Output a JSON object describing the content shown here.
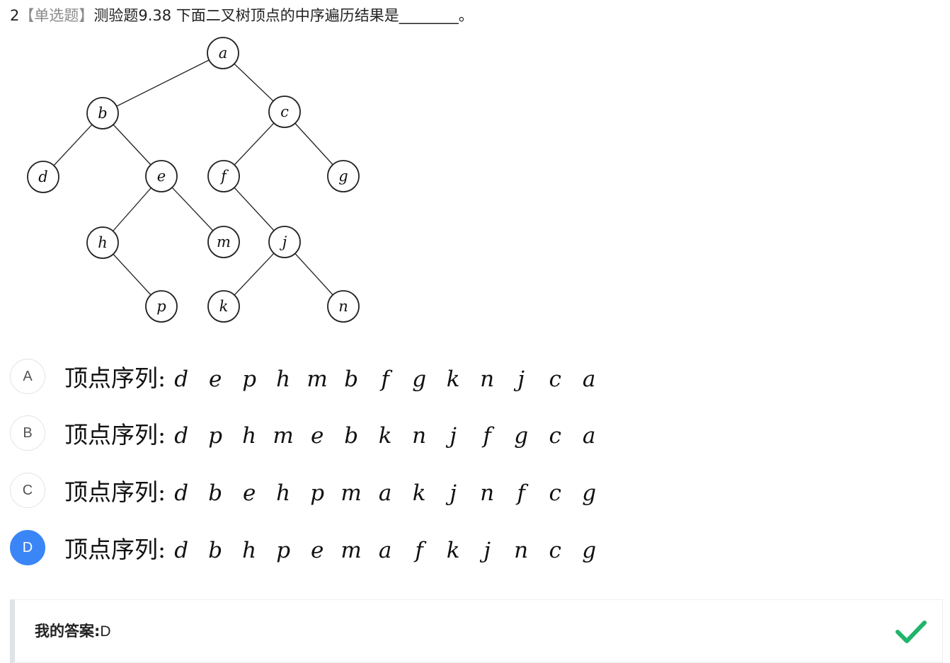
{
  "question": {
    "number": "2",
    "type_label": "【单选题】",
    "text": "测验题9.38 下面二叉树顶点的中序遍历结果是________。"
  },
  "tree": {
    "nodes": [
      {
        "id": "a",
        "label": "a"
      },
      {
        "id": "b",
        "label": "b"
      },
      {
        "id": "c",
        "label": "c"
      },
      {
        "id": "d",
        "label": "d"
      },
      {
        "id": "e",
        "label": "e"
      },
      {
        "id": "f",
        "label": "f"
      },
      {
        "id": "g",
        "label": "g"
      },
      {
        "id": "h",
        "label": "h"
      },
      {
        "id": "m",
        "label": "m"
      },
      {
        "id": "j",
        "label": "j"
      },
      {
        "id": "p",
        "label": "p"
      },
      {
        "id": "k",
        "label": "k"
      },
      {
        "id": "n",
        "label": "n"
      }
    ],
    "edges": [
      [
        "a",
        "b"
      ],
      [
        "a",
        "c"
      ],
      [
        "b",
        "d"
      ],
      [
        "b",
        "e"
      ],
      [
        "c",
        "f"
      ],
      [
        "c",
        "g"
      ],
      [
        "e",
        "h"
      ],
      [
        "e",
        "m"
      ],
      [
        "f",
        "j"
      ],
      [
        "h",
        "p"
      ],
      [
        "j",
        "k"
      ],
      [
        "j",
        "n"
      ]
    ]
  },
  "options": [
    {
      "letter": "A",
      "label": "顶点序列:",
      "sequence": [
        "d",
        "e",
        "p",
        "h",
        "m",
        "b",
        "f",
        "g",
        "k",
        "n",
        "j",
        "c",
        "a"
      ],
      "selected": false
    },
    {
      "letter": "B",
      "label": "顶点序列:",
      "sequence": [
        "d",
        "p",
        "h",
        "m",
        "e",
        "b",
        "k",
        "n",
        "j",
        "f",
        "g",
        "c",
        "a"
      ],
      "selected": false
    },
    {
      "letter": "C",
      "label": "顶点序列:",
      "sequence": [
        "d",
        "b",
        "e",
        "h",
        "p",
        "m",
        "a",
        "k",
        "j",
        "n",
        "f",
        "c",
        "g"
      ],
      "selected": false
    },
    {
      "letter": "D",
      "label": "顶点序列:",
      "sequence": [
        "d",
        "b",
        "h",
        "p",
        "e",
        "m",
        "a",
        "f",
        "k",
        "j",
        "n",
        "c",
        "g"
      ],
      "selected": true
    }
  ],
  "answer": {
    "label": "我的答案:",
    "value": "D",
    "status_icon": "check-icon",
    "status_color": "#1fb56a"
  },
  "colors": {
    "selected_accent": "#3b86f6",
    "type_label": "#8a8a8a"
  }
}
